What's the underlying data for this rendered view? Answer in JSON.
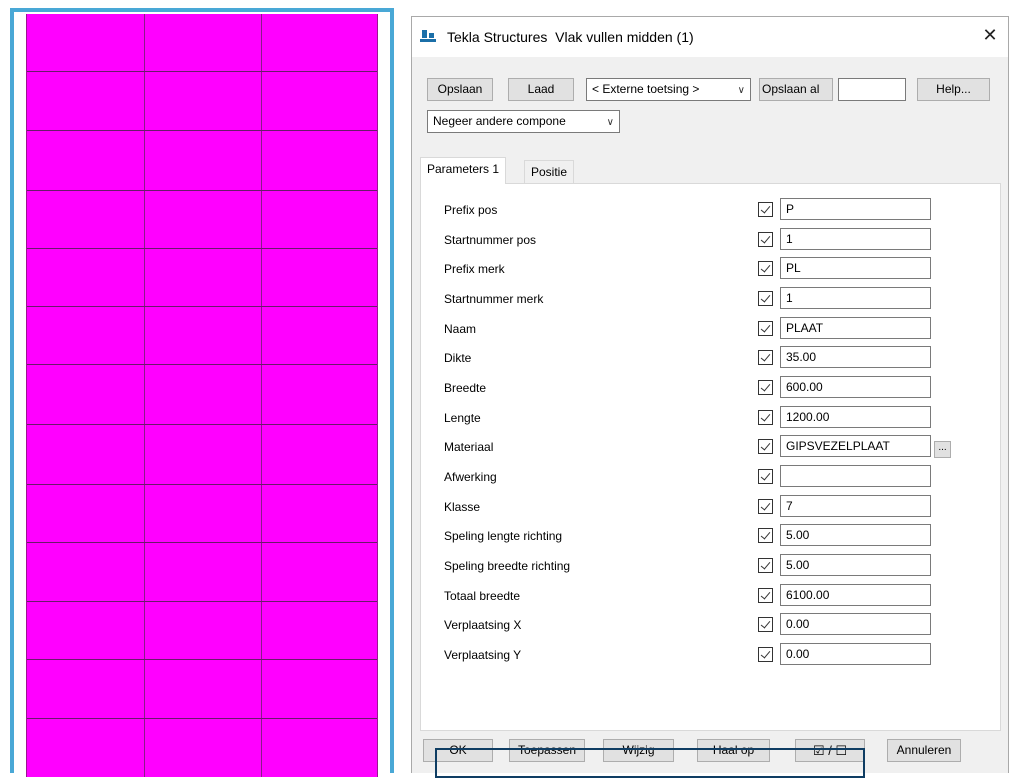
{
  "dialog": {
    "title": "Tekla Structures  Vlak vullen midden (1)",
    "close_glyph": "✕",
    "icon": "tekla-app-icon"
  },
  "toolbar": {
    "save_label": "Opslaan",
    "load_label": "Laad",
    "preset_value": "< Externe toetsing >",
    "save_as_label": "Opslaan al",
    "save_as_name_value": "",
    "help_label": "Help...",
    "filter_value": "Negeer andere compone"
  },
  "tabs": [
    {
      "label": "Parameters 1",
      "active": true
    },
    {
      "label": "Positie",
      "active": false
    }
  ],
  "params": [
    {
      "label": "Prefix pos",
      "value": "P",
      "checked": true
    },
    {
      "label": "Startnummer pos",
      "value": "1",
      "checked": true
    },
    {
      "label": "Prefix merk",
      "value": "PL",
      "checked": true
    },
    {
      "label": "Startnummer merk",
      "value": "1",
      "checked": true
    },
    {
      "label": "Naam",
      "value": "PLAAT",
      "checked": true
    },
    {
      "label": "Dikte",
      "value": "35.00",
      "checked": true
    },
    {
      "label": "Breedte",
      "value": "600.00",
      "checked": true
    },
    {
      "label": "Lengte",
      "value": "1200.00",
      "checked": true
    },
    {
      "label": "Materiaal",
      "value": "GIPSVEZELPLAAT",
      "checked": true,
      "browse_label": "..."
    },
    {
      "label": "Afwerking",
      "value": "",
      "checked": true
    },
    {
      "label": "Klasse",
      "value": "7",
      "checked": true
    },
    {
      "label": "Speling lengte richting",
      "value": "5.00",
      "checked": true
    },
    {
      "label": "Speling breedte richting",
      "value": "5.00",
      "checked": true
    },
    {
      "label": "Totaal breedte",
      "value": "6100.00",
      "checked": true,
      "highlighted": true
    },
    {
      "label": "Verplaatsing X",
      "value": "0.00",
      "checked": true
    },
    {
      "label": "Verplaatsing Y",
      "value": "0.00",
      "checked": true
    }
  ],
  "footer": {
    "ok_label": "OK",
    "apply_label": "Toepassen",
    "modify_label": "Wijzig",
    "get_label": "Haal op",
    "toggle_label": "☑ / ☐",
    "cancel_label": "Annuleren"
  },
  "colors": {
    "plate_fill": "#ff00ff",
    "plate_edge": "#8a1a8a",
    "view_border": "#49a8d6",
    "highlight_border": "#0f3d63"
  }
}
